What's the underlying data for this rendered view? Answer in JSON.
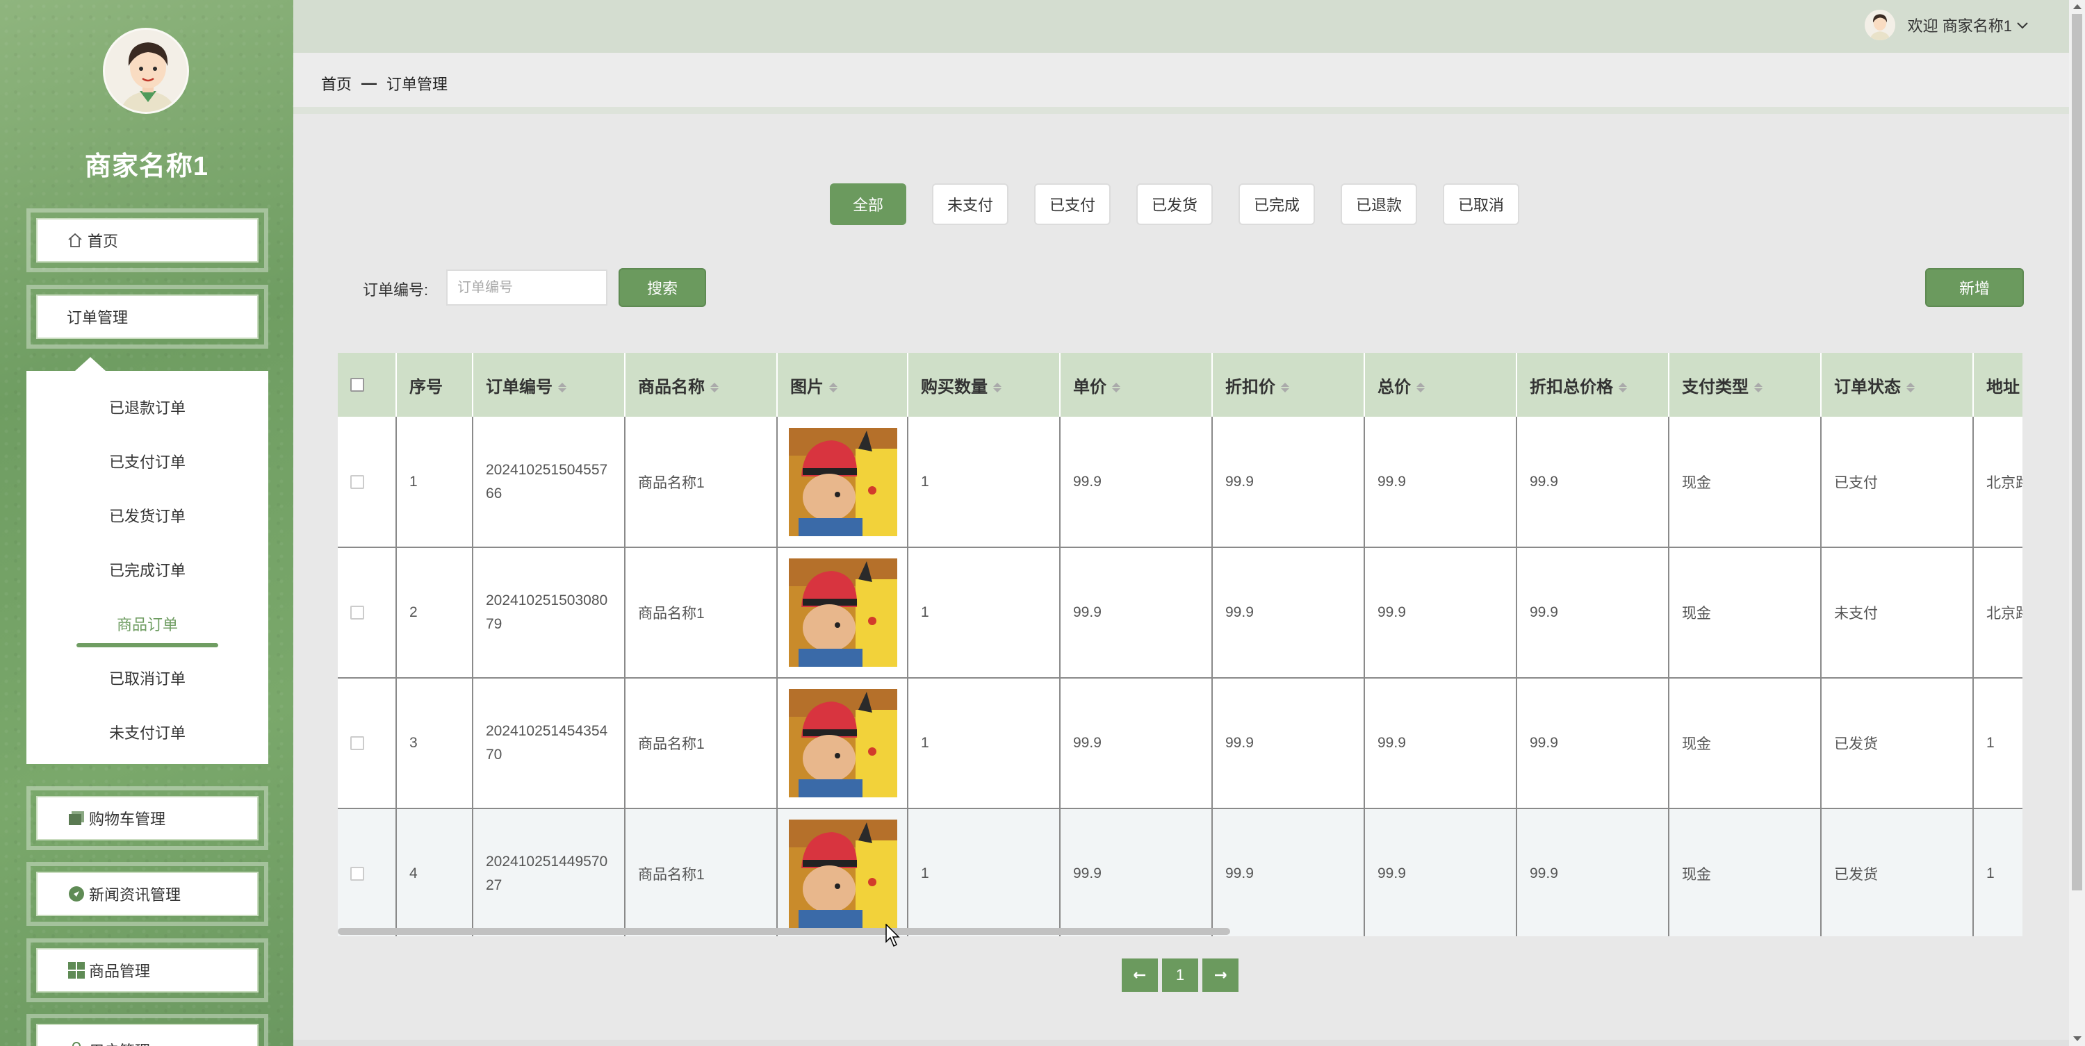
{
  "sidebar": {
    "merchant_name": "商家名称1",
    "menu": [
      {
        "label": "首页",
        "icon": "home-icon"
      },
      {
        "label": "订单管理",
        "icon": ""
      },
      {
        "label": "购物车管理",
        "icon": "cart-icon"
      },
      {
        "label": "新闻资讯管理",
        "icon": "news-icon"
      },
      {
        "label": "商品管理",
        "icon": "grid-icon"
      },
      {
        "label": "用户管理",
        "icon": "user-icon"
      }
    ],
    "submenu": [
      {
        "label": "已退款订单"
      },
      {
        "label": "已支付订单"
      },
      {
        "label": "已发货订单"
      },
      {
        "label": "已完成订单"
      },
      {
        "label": "商品订单",
        "active": true
      },
      {
        "label": "已取消订单"
      },
      {
        "label": "未支付订单"
      }
    ]
  },
  "topbar": {
    "welcome": "欢迎 商家名称1"
  },
  "breadcrumb": {
    "home": "首页",
    "sep": "—",
    "current": "订单管理"
  },
  "tabs": [
    "全部",
    "未支付",
    "已支付",
    "已发货",
    "已完成",
    "已退款",
    "已取消"
  ],
  "search": {
    "label": "订单编号:",
    "placeholder": "订单编号",
    "button": "搜索",
    "add_button": "新增"
  },
  "table": {
    "headers": [
      "序号",
      "订单编号",
      "商品名称",
      "图片",
      "购买数量",
      "单价",
      "折扣价",
      "总价",
      "折扣总价格",
      "支付类型",
      "订单状态",
      "地址"
    ],
    "rows": [
      {
        "index": "1",
        "order_no_line1": "202410251504557",
        "order_no_line2": "66",
        "product": "商品名称1",
        "qty": "1",
        "price": "99.9",
        "discount": "99.9",
        "total": "99.9",
        "discount_total": "99.9",
        "pay_type": "现金",
        "status": "已支付",
        "address": "北京路"
      },
      {
        "index": "2",
        "order_no_line1": "202410251503080",
        "order_no_line2": "79",
        "product": "商品名称1",
        "qty": "1",
        "price": "99.9",
        "discount": "99.9",
        "total": "99.9",
        "discount_total": "99.9",
        "pay_type": "现金",
        "status": "未支付",
        "address": "北京路"
      },
      {
        "index": "3",
        "order_no_line1": "202410251454354",
        "order_no_line2": "70",
        "product": "商品名称1",
        "qty": "1",
        "price": "99.9",
        "discount": "99.9",
        "total": "99.9",
        "discount_total": "99.9",
        "pay_type": "现金",
        "status": "已发货",
        "address": "1"
      },
      {
        "index": "4",
        "order_no_line1": "202410251449570",
        "order_no_line2": "27",
        "product": "商品名称1",
        "qty": "1",
        "price": "99.9",
        "discount": "99.9",
        "total": "99.9",
        "discount_total": "99.9",
        "pay_type": "现金",
        "status": "已发货",
        "address": "1"
      }
    ]
  },
  "pagination": {
    "current": "1"
  },
  "colors": {
    "accent": "#6b9a5e",
    "sidebar": "#7aa86b",
    "header_row": "#cfdfc8"
  }
}
